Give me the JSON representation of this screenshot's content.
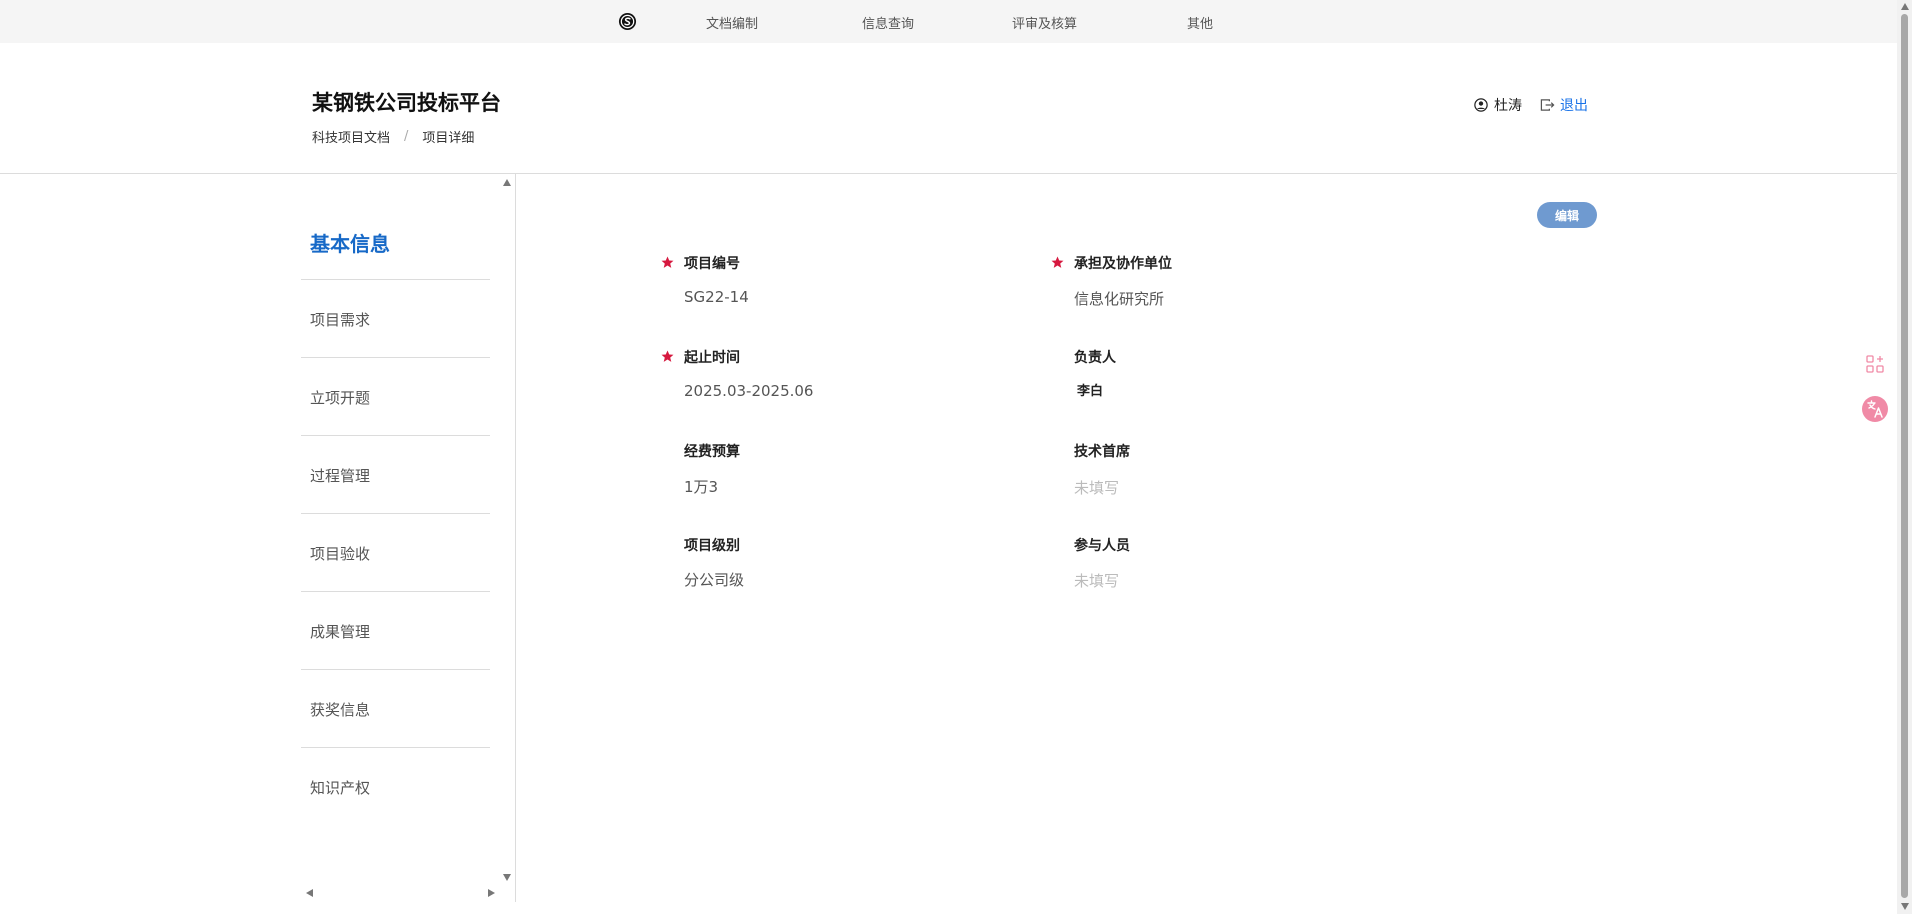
{
  "topnav": {
    "logo_icon": "brand-s-logo-icon",
    "items": [
      {
        "label": "文档编制"
      },
      {
        "label": "信息查询"
      },
      {
        "label": "评审及核算"
      },
      {
        "label": "其他"
      }
    ]
  },
  "header": {
    "title": "某钢铁公司投标平台",
    "breadcrumb": [
      "科技项目文档",
      "项目详细"
    ],
    "breadcrumb_separator": "/",
    "user": {
      "icon": "user-circle-icon",
      "name": "杜涛"
    },
    "logout": {
      "icon": "logout-icon",
      "label": "退出"
    }
  },
  "sidebar": {
    "title": "基本信息",
    "items": [
      {
        "label": "项目需求"
      },
      {
        "label": "立项开题"
      },
      {
        "label": "过程管理"
      },
      {
        "label": "项目验收"
      },
      {
        "label": "成果管理"
      },
      {
        "label": "获奖信息"
      },
      {
        "label": "知识产权"
      }
    ]
  },
  "main": {
    "edit_label": "编辑",
    "fields": [
      {
        "label": "项目编号",
        "value": "SG22-14",
        "required": true
      },
      {
        "label": "承担及协作单位",
        "value": "信息化研究所",
        "required": true
      },
      {
        "label": "起止时间",
        "value": "2025.03-2025.06",
        "required": true
      },
      {
        "label": "负责人",
        "value": "李白",
        "required": false
      },
      {
        "label": "经费预算",
        "value": "1万3",
        "required": false
      },
      {
        "label": "技术首席",
        "value": "未填写",
        "required": false
      },
      {
        "label": "项目级别",
        "value": "分公司级",
        "required": false
      },
      {
        "label": "参与人员",
        "value": "未填写",
        "required": false
      }
    ]
  },
  "colors": {
    "accent": "#1769c7",
    "required_star": "#d6193f",
    "edit_button": "#6f9ad0",
    "logout_link": "#1a73e8",
    "float_tool": "#f08aa6"
  },
  "float_tools": [
    {
      "icon": "apps-grid-icon"
    },
    {
      "icon": "translate-icon"
    }
  ]
}
